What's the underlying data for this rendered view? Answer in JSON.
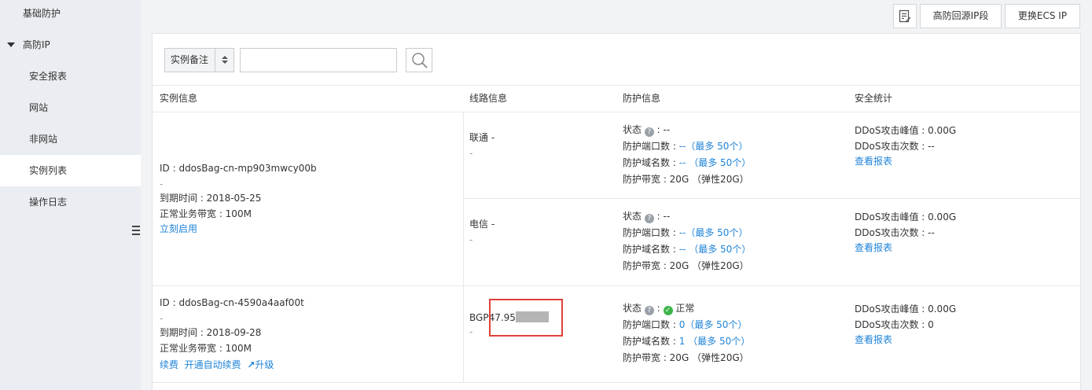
{
  "sidebar": {
    "top_item": "基础防护",
    "group_label": "高防IP",
    "sub_items": [
      "安全报表",
      "网站",
      "非网站",
      "实例列表",
      "操作日志"
    ]
  },
  "toolbar": {
    "icon": "edit-note-icon",
    "btn_ip_segment": "高防回源IP段",
    "btn_change_ecs": "更换ECS IP"
  },
  "filter": {
    "select_value": "实例备注",
    "search_value": ""
  },
  "table": {
    "headers": [
      "实例信息",
      "线路信息",
      "防护信息",
      "安全统计"
    ],
    "instances": [
      {
        "id": "ID : ddosBag-cn-mp903mwcy00b",
        "remark": "-",
        "expire": "到期时间 : 2018-05-25",
        "bandwidth": "正常业务带宽 : 100M",
        "actions": [
          "立刻启用"
        ],
        "lines": [
          {
            "name": "联通 -",
            "sub": "-",
            "status_label": "状态",
            "status_value": ": --",
            "ports_label": "防护端口数 :",
            "ports_value": "--",
            "ports_max": "（最多 50个）",
            "domains_label": "防护域名数 :",
            "domains_value": "--",
            "domains_max": "（最多 50个）",
            "bw": "防护带宽 : 20G （弹性20G）",
            "peak": "DDoS攻击峰值 : 0.00G",
            "count": "DDoS攻击次数 : --",
            "report": "查看报表"
          },
          {
            "name": "电信 -",
            "sub": "-",
            "status_label": "状态",
            "status_value": ": --",
            "ports_label": "防护端口数 :",
            "ports_value": "--",
            "ports_max": "（最多 50个）",
            "domains_label": "防护域名数 :",
            "domains_value": "--",
            "domains_max": "（最多 50个）",
            "bw": "防护带宽 : 20G （弹性20G）",
            "peak": "DDoS攻击峰值 : 0.00G",
            "count": "DDoS攻击次数 : --",
            "report": "查看报表"
          }
        ]
      },
      {
        "id": "ID : ddosBag-cn-4590a4aaf00t",
        "remark": "-",
        "expire": "到期时间 : 2018-09-28",
        "bandwidth": "正常业务带宽 : 100M",
        "actions": [
          "续费",
          "开通自动续费",
          "升级"
        ],
        "lines": [
          {
            "name": "BGP",
            "ip": "47.95",
            "sub": "-",
            "status_label": "状态",
            "status_value": "正常",
            "ports_label": "防护端口数 :",
            "ports_value": "0",
            "ports_max": "（最多 50个）",
            "domains_label": "防护域名数 :",
            "domains_value": "1",
            "domains_max": "（最多 50个）",
            "bw": "防护带宽 : 20G （弹性20G）",
            "peak": "DDoS攻击峰值 : 0.00G",
            "count": "DDoS攻击次数 : 0",
            "report": "查看报表"
          }
        ]
      }
    ]
  },
  "colors": {
    "link": "#1f84d8",
    "highlight_box": "#e0413a",
    "ok": "#3eb54a"
  }
}
